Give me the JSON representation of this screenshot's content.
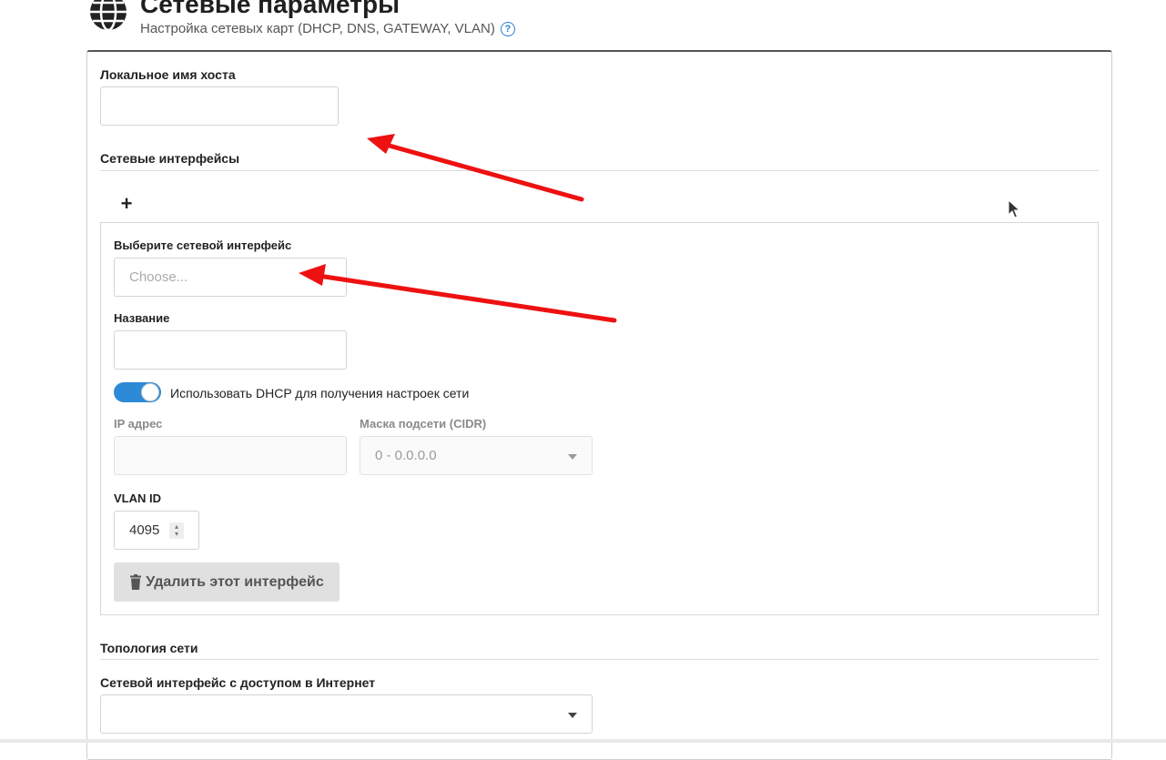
{
  "header": {
    "title": "Сетевые параметры",
    "subtitle": "Настройка сетевых карт (DHCP, DNS, GATEWAY, VLAN)",
    "help_icon": "?"
  },
  "hostname": {
    "label": "Локальное имя хоста",
    "value": ""
  },
  "interfaces": {
    "section_title": "Сетевые интерфейсы",
    "add_label": "+",
    "select_label": "Выберите сетевой интерфейс",
    "select_placeholder": "Choose...",
    "name_label": "Название",
    "name_value": "",
    "dhcp_label": "Использовать DHCP для получения настроек сети",
    "dhcp_enabled": true,
    "ip_label": "IP адрес",
    "ip_value": "",
    "mask_label": "Маска подсети (CIDR)",
    "mask_value": "0 - 0.0.0.0",
    "vlan_label": "VLAN ID",
    "vlan_value": "4095",
    "delete_label": "Удалить этот интерфейс"
  },
  "topology": {
    "section_title": "Топология сети",
    "internet_label": "Сетевой интерфейс с доступом в Интернет",
    "internet_value": ""
  },
  "colors": {
    "accent": "#2d8ad6",
    "annotation_arrow": "#ee1111"
  },
  "icons": {
    "header": "globe-icon",
    "help": "question-circle-icon",
    "delete": "trash-icon"
  }
}
